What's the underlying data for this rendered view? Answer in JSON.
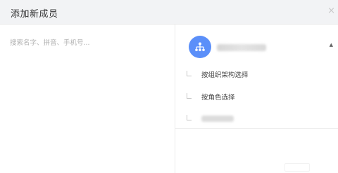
{
  "dialog": {
    "title": "添加新成员",
    "close_glyph": "×"
  },
  "search": {
    "placeholder": "搜索名字、拼音、手机号..."
  },
  "organization": {
    "icon": "org-tree-icon",
    "caret_glyph": "▲",
    "options": [
      {
        "label": "按组织架构选择"
      },
      {
        "label": "按角色选择"
      }
    ]
  },
  "colors": {
    "accent": "#5b8ff9",
    "header_bg": "#f2f3f5"
  }
}
